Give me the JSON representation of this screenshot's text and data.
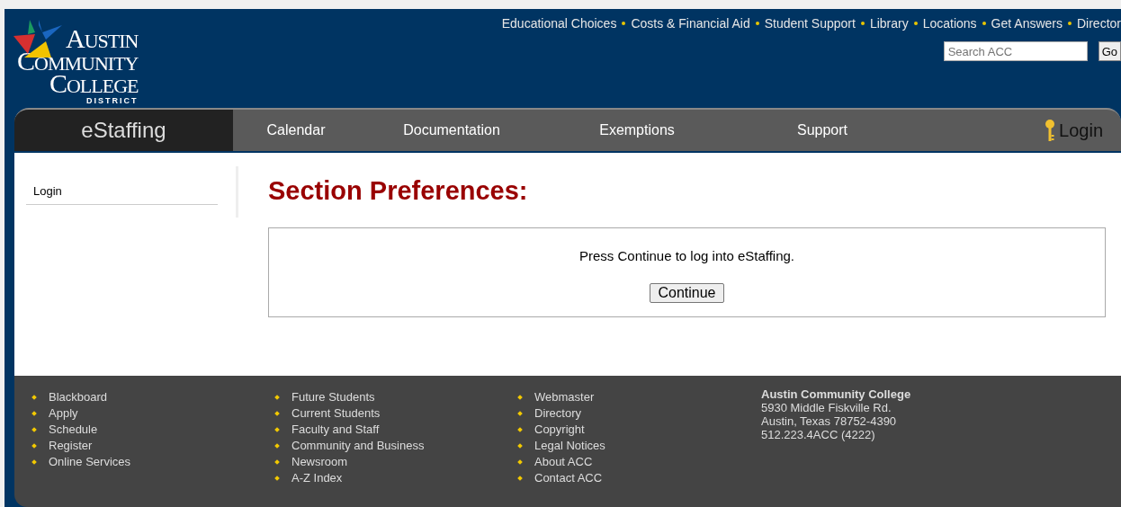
{
  "logo": {
    "lines": [
      "AUSTIN",
      "COMMUNITY",
      "COLLEGE"
    ],
    "subline": "DISTRICT"
  },
  "top_links": [
    "Educational Choices",
    "Costs & Financial Aid",
    "Student Support",
    "Library",
    "Locations",
    "Get Answers",
    "Director"
  ],
  "search": {
    "placeholder": "Search ACC",
    "button": "Go"
  },
  "nav": {
    "brand": "eStaffing",
    "items": [
      "Calendar",
      "Documentation",
      "Exemptions",
      "Support"
    ],
    "login": "Login"
  },
  "sidebar": {
    "items": [
      "Login"
    ]
  },
  "content": {
    "heading": "Section Preferences:",
    "message": "Press Continue to log into eStaffing.",
    "button": "Continue"
  },
  "footer": {
    "columns": [
      [
        "Blackboard",
        "Apply",
        "Schedule",
        "Register",
        "Online Services"
      ],
      [
        "Future Students",
        "Current Students",
        "Faculty and Staff",
        "Community and Business",
        "Newsroom",
        "A-Z Index"
      ],
      [
        "Webmaster",
        "Directory",
        "Copyright",
        "Legal Notices",
        "About ACC",
        "Contact ACC"
      ]
    ],
    "address": {
      "name": "Austin Community College",
      "lines": [
        "5930 Middle Fiskville Rd.",
        "Austin, Texas 78752-4390",
        "512.223.4ACC (4222)"
      ]
    }
  }
}
